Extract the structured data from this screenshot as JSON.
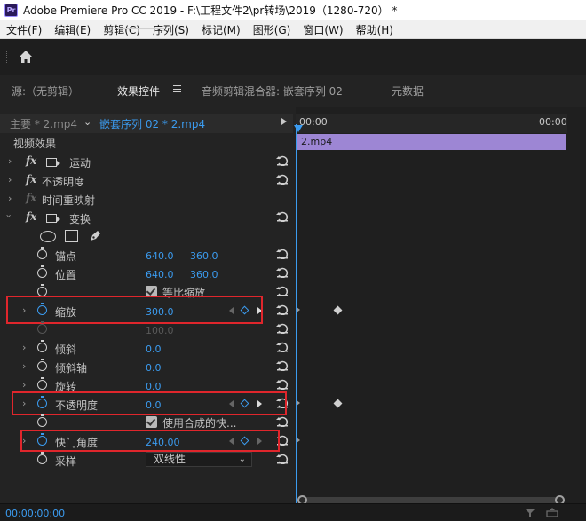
{
  "window": {
    "app_icon": "Pr",
    "title": "Adobe Premiere Pro CC 2019 - F:\\工程文件2\\pr转场\\2019（1280-720）  *"
  },
  "menu": [
    "文件(F)",
    "编辑(E)",
    "剪辑(C)",
    "序列(S)",
    "标记(M)",
    "图形(G)",
    "窗口(W)",
    "帮助(H)"
  ],
  "panel_tabs": {
    "source": "源:（无剪辑）",
    "effect_controls": "效果控件",
    "audio_mixer": "音频剪辑混合器: 嵌套序列 02",
    "metadata": "元数据"
  },
  "clip_header": {
    "master": "主要 * 2.mp4",
    "sequence": "嵌套序列 02 * 2.mp4"
  },
  "section": {
    "video_effects": "视频效果"
  },
  "effects": {
    "motion": "运动",
    "opacity": "不透明度",
    "time_remap": "时间重映射",
    "transform": "变换"
  },
  "transform": {
    "anchor": {
      "label": "锚点",
      "x": "640.0",
      "y": "360.0"
    },
    "position": {
      "label": "位置",
      "x": "640.0",
      "y": "360.0"
    },
    "uniform_scale": {
      "label": "等比缩放",
      "checked": true
    },
    "scale": {
      "label": "缩放",
      "value": "300.0"
    },
    "scale_width": {
      "value": "100.0"
    },
    "skew": {
      "label": "倾斜",
      "value": "0.0"
    },
    "skew_axis": {
      "label": "倾斜轴",
      "value": "0.0"
    },
    "rotation": {
      "label": "旋转",
      "value": "0.0"
    },
    "opacity": {
      "label": "不透明度",
      "value": "0.0"
    },
    "use_comp_shutter": {
      "label": "使用合成的快...",
      "checked": true
    },
    "shutter_angle": {
      "label": "快门角度",
      "value": "240.00"
    },
    "sampling": {
      "label": "采样",
      "value": "双线性"
    }
  },
  "timeline": {
    "start_time": "00:00",
    "end_time": "00:00",
    "clip_label": "2.mp4",
    "clip_color": "#9d86d4"
  },
  "status": {
    "timecode": "00:00:00:00"
  },
  "colors": {
    "accent": "#3b9bef",
    "highlight_box": "#e0262c"
  }
}
